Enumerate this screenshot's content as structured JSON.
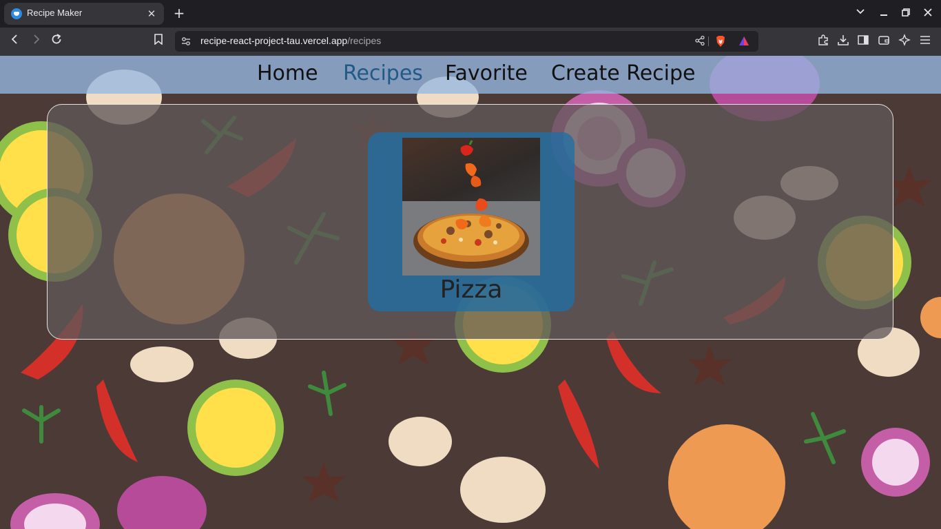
{
  "browser": {
    "tab_title": "Recipe Maker",
    "url_host": "recipe-react-project-tau.vercel.app",
    "url_path": "/recipes",
    "icons": {
      "back": "back-arrow-icon",
      "forward": "forward-arrow-icon",
      "reload": "reload-icon",
      "bookmark": "bookmark-icon",
      "site_info": "site-settings-icon",
      "share": "share-icon",
      "shields": "brave-shields-icon",
      "rewards": "brave-rewards-icon",
      "extensions": "extensions-icon",
      "downloads": "download-icon",
      "sidebar": "sidebar-icon",
      "wallet": "wallet-icon",
      "leo": "leo-ai-icon",
      "menu": "hamburger-menu-icon"
    }
  },
  "site": {
    "nav": [
      {
        "label": "Home",
        "active": false
      },
      {
        "label": "Recipes",
        "active": true
      },
      {
        "label": "Favorite",
        "active": false
      },
      {
        "label": "Create Recipe",
        "active": false
      }
    ],
    "recipes": [
      {
        "title": "Pizza",
        "image": "pizza-photo"
      }
    ]
  },
  "colors": {
    "nav_active": "#215a86",
    "card_bg": "#206ea5",
    "page_bg": "#4a3a37"
  }
}
